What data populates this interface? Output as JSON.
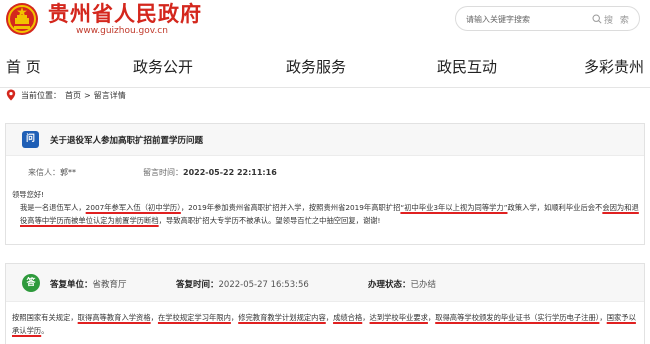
{
  "header": {
    "site_title": "贵州省人民政府",
    "site_url": "www.guizhou.gov.cn",
    "search_placeholder": "请输入关键字搜索",
    "search_button": "搜 索"
  },
  "nav": {
    "items": [
      "首 页",
      "政务公开",
      "政务服务",
      "政民互动",
      "多彩贵州"
    ]
  },
  "breadcrumb": {
    "label": "当前位置：",
    "items": [
      "首页",
      "留言详情"
    ],
    "separator": ">"
  },
  "question": {
    "badge": "问",
    "title": "关于退役军人参加高职扩招前置学历问题",
    "sender_label": "来信人：",
    "sender_value": "郭**",
    "time_label": "留言时间：",
    "time_value": "2022-05-22 22:11:16",
    "greeting": "领导您好!",
    "body_parts": [
      "我是一名退伍军人，",
      "2007年参军入伍（初中学历）",
      "，2019年参加贵州省高职扩招并入学，按照贵州省2019年高职扩招",
      "“初中毕业3年以上视为同等学力”",
      "政策入学，如顺利毕业后会不",
      "会因为和退役高等中学历而被单位认定为前置学历断档",
      "，导致高职扩招大专学历不被承认。望领导百忙之中抽空回复，谢谢!"
    ]
  },
  "answer": {
    "badge": "答",
    "unit_label": "答复单位：",
    "unit_value": "省教育厅",
    "time_label": "答复时间：",
    "time_value": "2022-05-27 16:53:56",
    "status_label": "办理状态：",
    "status_value": "已办结",
    "body_parts": [
      "按照国家有关规定，",
      "取得高等教育入学资格",
      "，",
      "在学校规定学习年限内",
      "，",
      "修完教育教学计划规定内容",
      "，",
      "成绩合格",
      "，",
      "达到学校毕业要求",
      "，",
      "取得高等学校颁发的毕业证书（实行学历电子注册）",
      "，",
      "国家予以承认学历",
      "。"
    ]
  },
  "colors": {
    "brand_red": "#d4271d",
    "question_blue": "#1f5fb6",
    "answer_green": "#2e9a3c",
    "underline_red": "#e02020"
  },
  "icons": [
    "national-emblem-icon",
    "search-icon",
    "location-pin-icon"
  ]
}
